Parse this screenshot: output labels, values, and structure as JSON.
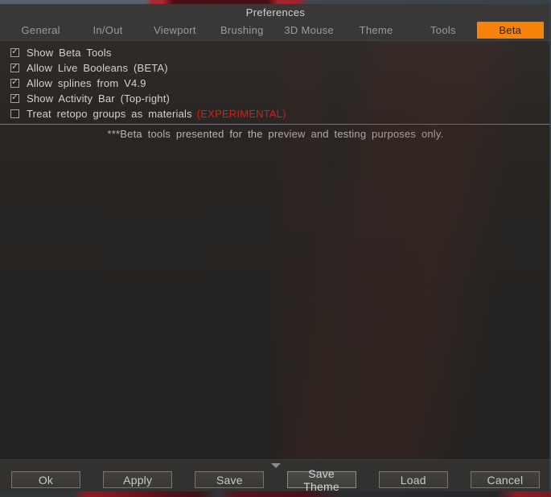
{
  "window": {
    "title": "Preferences"
  },
  "tabs": [
    {
      "label": "General",
      "active": false
    },
    {
      "label": "In/Out",
      "active": false
    },
    {
      "label": "Viewport",
      "active": false
    },
    {
      "label": "Brushing",
      "active": false
    },
    {
      "label": "3D Mouse",
      "active": false
    },
    {
      "label": "Theme",
      "active": false
    },
    {
      "label": "Tools",
      "active": false
    },
    {
      "label": "Beta",
      "active": true
    }
  ],
  "options": [
    {
      "label": "Show Beta Tools",
      "checked": true
    },
    {
      "label": "Allow Live Booleans (BETA)",
      "checked": true
    },
    {
      "label": "Allow splines from V4.9",
      "checked": true
    },
    {
      "label": "Show Activity Bar (Top-right)",
      "checked": true
    },
    {
      "label": "Treat retopo groups as materials",
      "suffix": "(EXPERIMENTAL)",
      "checked": false
    }
  ],
  "note": "***Beta tools presented for the preview and testing purposes only.",
  "footer": {
    "buttons": [
      "Ok",
      "Apply",
      "Save",
      "Save Theme",
      "Load",
      "Cancel"
    ]
  },
  "colors": {
    "accent_tab": "#F8830B",
    "experimental_text": "#DC1D12"
  }
}
